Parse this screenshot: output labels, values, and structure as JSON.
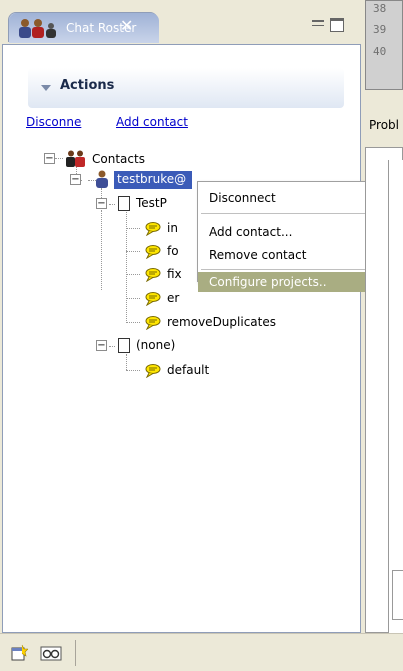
{
  "roster": {
    "tab_title": "Chat Roster",
    "actions_title": "Actions",
    "actions": {
      "disconnect_label": "Disconne",
      "add_contact_label": "Add contact"
    },
    "tree": {
      "root_label": "Contacts",
      "user_label": "testbruke@",
      "project_label": "TestP",
      "project_children": [
        "in",
        "fo",
        "fix",
        "er",
        "removeDuplicates"
      ],
      "none_label": "(none)",
      "none_children": [
        "default"
      ]
    }
  },
  "context_menu": {
    "items": [
      "Disconnect",
      "Add contact...",
      "Remove contact",
      "Configure projects.."
    ],
    "selected_index": 3
  },
  "right_panel": {
    "code_lines": [
      "38",
      "39",
      "40"
    ],
    "problems_tab_label": "Probl"
  },
  "colors": {
    "selection": "#3b5bb8",
    "menu_highlight": "#a9ad82",
    "link": "#0000cc",
    "comment_bubble": "#ffe600"
  },
  "icons": {
    "view_icon": "chat-roster-icon",
    "root": "contacts-group-icon",
    "user": "user-icon",
    "project": "document-icon",
    "item": "comment-bubble-icon",
    "toolbar": [
      "new-view-icon",
      "glasses-icon"
    ]
  }
}
